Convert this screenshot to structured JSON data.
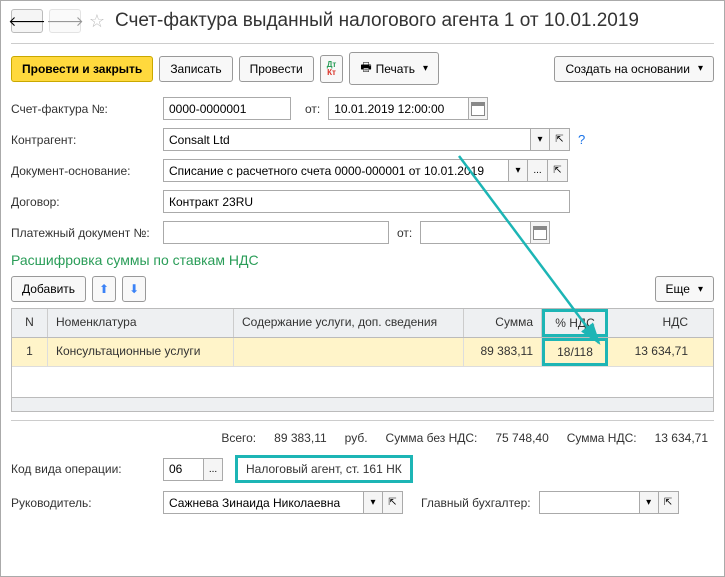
{
  "title": "Счет-фактура выданный налогового агента 1 от 10.01.2019",
  "toolbar": {
    "post_close": "Провести и закрыть",
    "save": "Записать",
    "post": "Провести",
    "print": "Печать",
    "create_based": "Создать на основании"
  },
  "form": {
    "invoice_no_label": "Счет-фактура №:",
    "invoice_no": "0000-0000001",
    "from_label": "от:",
    "date": "10.01.2019 12:00:00",
    "counterparty_label": "Контрагент:",
    "counterparty": "Consalt Ltd",
    "basis_doc_label": "Документ-основание:",
    "basis_doc": "Списание с расчетного счета 0000-000001 от 10.01.2019",
    "contract_label": "Договор:",
    "contract": "Контракт 23RU",
    "payment_doc_label": "Платежный документ №:",
    "payment_doc": "",
    "payment_from_label": "от:",
    "payment_date": ""
  },
  "section": {
    "title": "Расшифровка суммы по ставкам НДС",
    "add": "Добавить",
    "more": "Еще"
  },
  "table": {
    "headers": {
      "n": "N",
      "nomenclature": "Номенклатура",
      "content": "Содержание услуги, доп. сведения",
      "sum": "Сумма",
      "vat_pct": "% НДС",
      "nds": "НДС"
    },
    "rows": [
      {
        "n": "1",
        "nomenclature": "Консультационные услуги",
        "content": "",
        "sum": "89 383,11",
        "vat_pct": "18/118",
        "nds": "13 634,71"
      }
    ]
  },
  "totals": {
    "total_label": "Всего:",
    "total": "89 383,11",
    "currency": "руб.",
    "no_vat_label": "Сумма без НДС:",
    "no_vat": "75 748,40",
    "vat_label": "Сумма НДС:",
    "vat": "13 634,71"
  },
  "footer": {
    "op_code_label": "Код вида операции:",
    "op_code": "06",
    "op_code_desc": "Налоговый агент, ст. 161 НК",
    "manager_label": "Руководитель:",
    "manager": "Сажнева Зинаида Николаевна",
    "accountant_label": "Главный бухгалтер:",
    "accountant": ""
  }
}
